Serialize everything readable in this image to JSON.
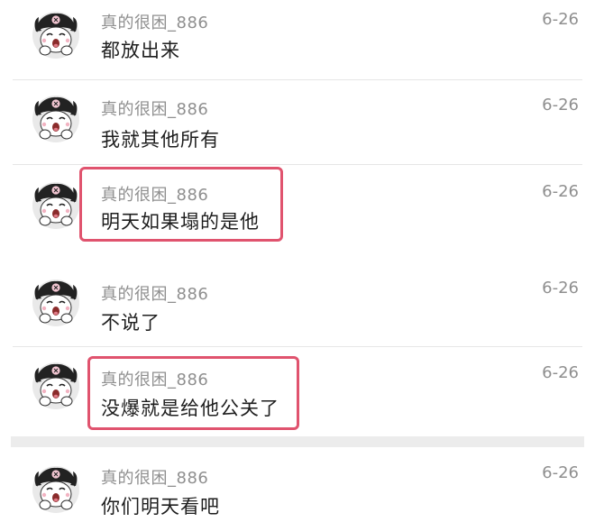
{
  "comments": [
    {
      "username": "真的很困_886",
      "text": "都放出来",
      "date": "6-26",
      "highlighted": false
    },
    {
      "username": "真的很困_886",
      "text": "我就其他所有",
      "date": "6-26",
      "highlighted": false
    },
    {
      "username": "真的很困_886",
      "text": "明天如果塌的是他",
      "date": "6-26",
      "highlighted": true
    },
    {
      "username": "真的很困_886",
      "text": "不说了",
      "date": "6-26",
      "highlighted": false
    },
    {
      "username": "真的很困_886",
      "text": "没爆就是给他公关了",
      "date": "6-26",
      "highlighted": true
    },
    {
      "username": "真的很困_886",
      "text": "你们明天看吧",
      "date": "6-26",
      "highlighted": false
    }
  ],
  "colors": {
    "highlight": "#e0536e",
    "username": "#8f8f8f",
    "message": "#1e1e1e"
  },
  "icons": {
    "avatar": "kuromi-avatar-icon"
  }
}
